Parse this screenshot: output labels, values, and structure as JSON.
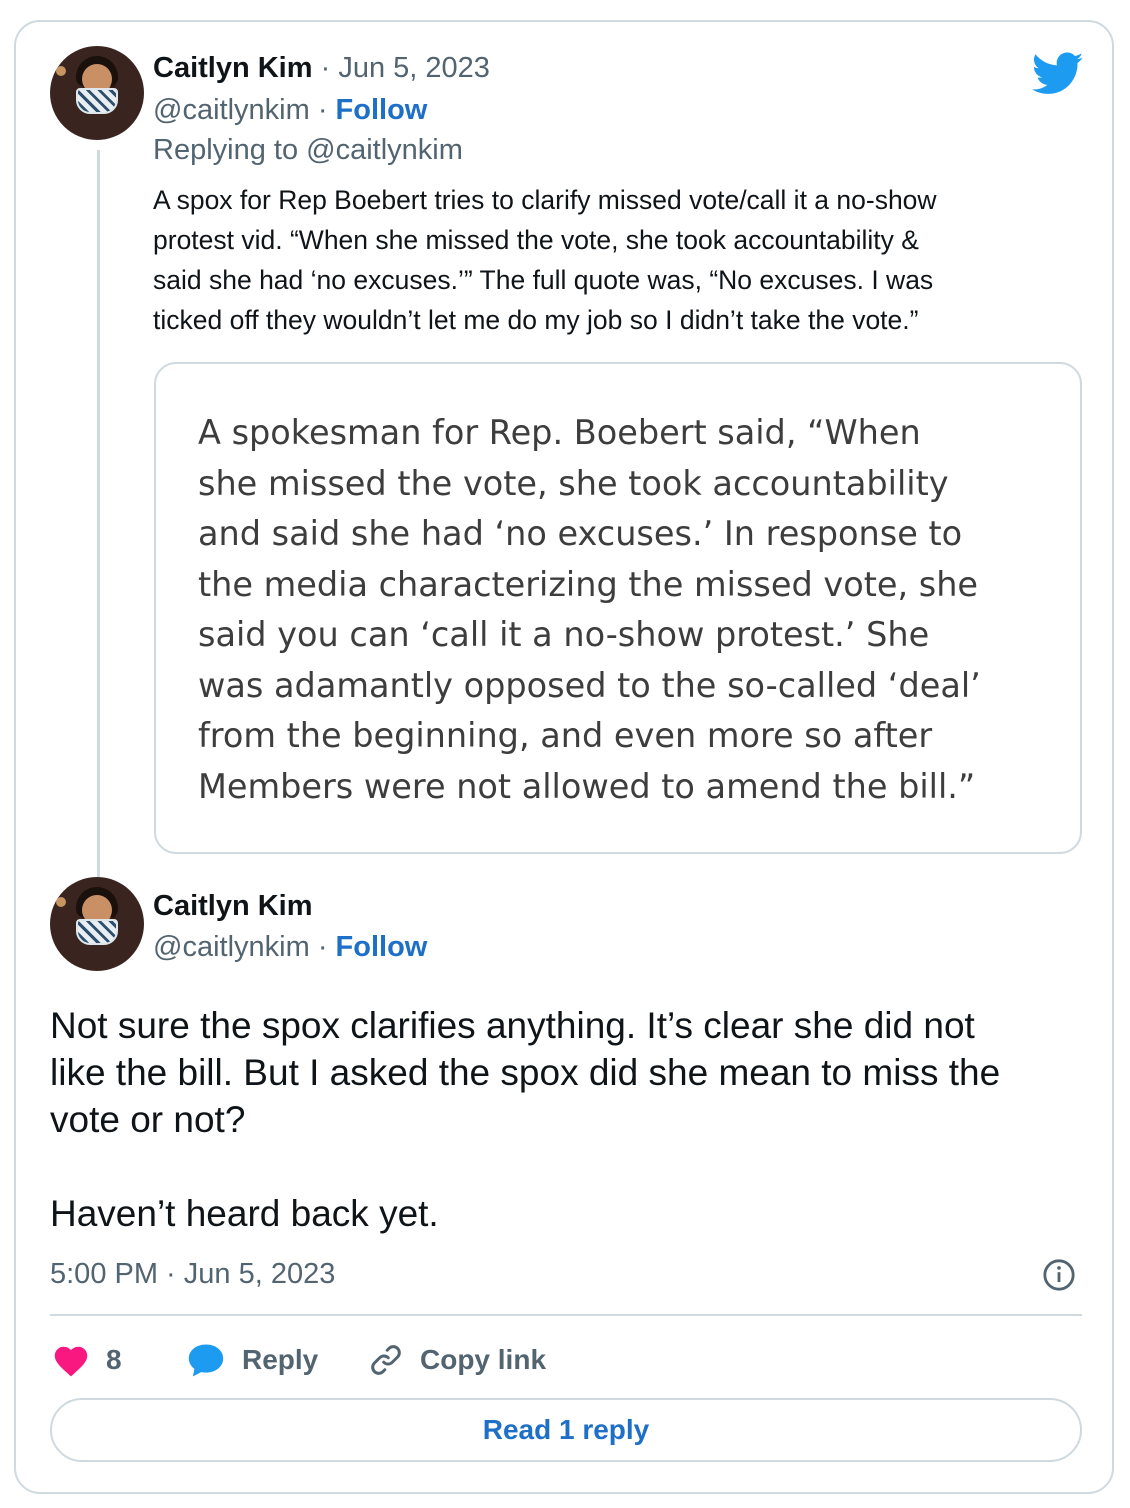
{
  "tweet1": {
    "author_name": "Caitlyn Kim",
    "date": "Jun 5, 2023",
    "handle": "@caitlynkim",
    "follow_label": "Follow",
    "separator": "·",
    "replying_to": "Replying to @caitlynkim",
    "text": "A spox for Rep Boebert tries to clarify missed vote/call it a no-show\nprotest vid. “When she missed the vote, she took accountability &\nsaid she had ‘no excuses.’”  The full quote was, “No excuses. I was\nticked off they wouldn’t let me do my job so I didn’t take the vote.”",
    "quote_image_text": "A spokesman for Rep. Boebert said, “When\nshe missed the vote, she took accountability\nand said she had ‘no excuses.’ In response to\nthe media characterizing the missed vote, she\nsaid you can ‘call it a no-show protest.’ She\nwas adamantly opposed to the so-called ‘deal’\nfrom the beginning, and even more so after\nMembers were not allowed to amend the bill.”"
  },
  "tweet2": {
    "author_name": "Caitlyn Kim",
    "handle": "@caitlynkim",
    "follow_label": "Follow",
    "separator": "·",
    "text": "Not sure the spox clarifies anything. It’s clear she did not\nlike the bill. But I asked the spox did she mean to miss the\nvote or not?\n\nHaven’t heard back yet.",
    "timestamp": "5:00 PM · Jun 5, 2023"
  },
  "actions": {
    "like_count": "8",
    "reply_label": "Reply",
    "copy_link_label": "Copy link",
    "read_replies_label": "Read 1 reply"
  },
  "colors": {
    "like": "#f91880",
    "reply_bubble": "#1d9bf0",
    "twitter_blue": "#1d9bf0",
    "link": "#1d6fc7",
    "muted": "#536471",
    "border": "#cfd9de"
  },
  "icons": {
    "brand": "twitter-bird-icon",
    "like": "heart-icon",
    "reply": "speech-bubble-icon",
    "copy_link": "link-icon",
    "info": "info-icon"
  }
}
